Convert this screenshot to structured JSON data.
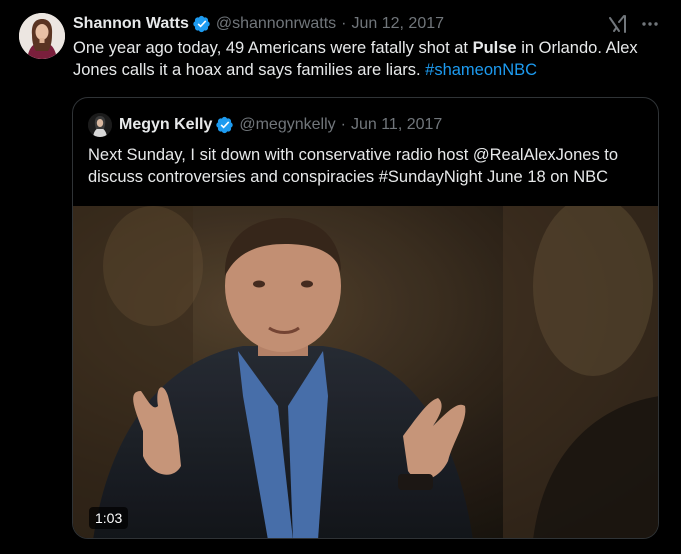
{
  "tweet": {
    "author_name": "Shannon Watts",
    "handle": "@shannonrwatts",
    "separator": "·",
    "date": "Jun 12, 2017",
    "text_part1": "One year ago today, 49 Americans were fatally shot at ",
    "text_bold": "Pulse",
    "text_part2": " in Orlando. Alex Jones calls it a hoax and says families are liars. ",
    "hashtag": "#shameonNBC"
  },
  "quoted": {
    "author_name": "Megyn Kelly",
    "handle": "@megynkelly",
    "separator": "·",
    "date": "Jun 11, 2017",
    "text": "Next Sunday, I sit down with conservative radio host @RealAlexJones to discuss controversies and conspiracies #SundayNight June 18 on NBC",
    "video_duration": "1:03"
  },
  "colors": {
    "background": "#000000",
    "text": "#e7e9ea",
    "muted": "#71767b",
    "link": "#1d9bf0",
    "verified": "#1d9bf0",
    "border": "#2f3336"
  },
  "icons": [
    "verified-badge-icon",
    "grok-icon",
    "more-options-icon"
  ]
}
